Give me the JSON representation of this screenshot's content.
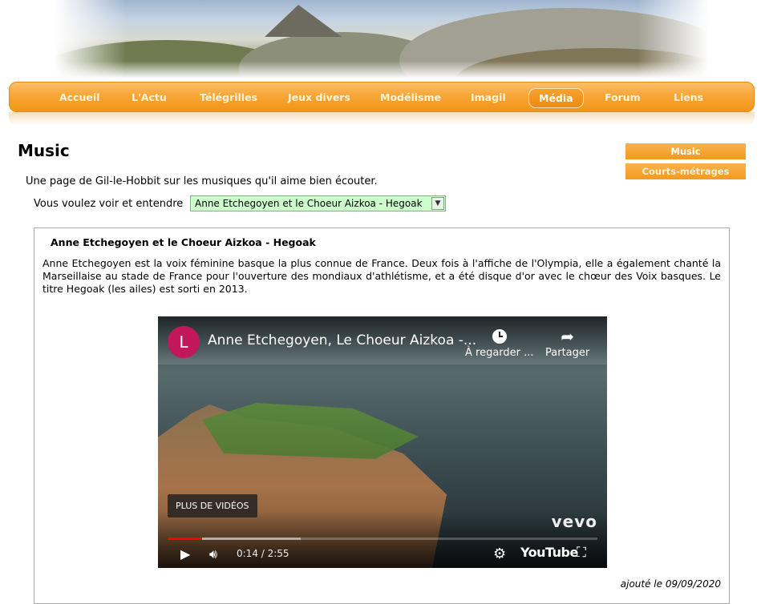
{
  "nav": {
    "items": [
      {
        "label": "Accueil"
      },
      {
        "label": "L'Actu"
      },
      {
        "label": "Télégrilles"
      },
      {
        "label": "Jeux divers"
      },
      {
        "label": "Modélisme"
      },
      {
        "label": "Imagil"
      },
      {
        "label": "Média",
        "active": true
      },
      {
        "label": "Forum"
      },
      {
        "label": "Liens"
      }
    ]
  },
  "page": {
    "title": "Music",
    "intro": "Une page de Gil-le-Hobbit sur les musiques qu'il aime bien écouter.",
    "selector_label": "Vous voulez voir et entendre",
    "selected_value": "Anne Etchegoyen et le Choeur Aizkoa - Hegoak"
  },
  "sidebar": {
    "items": [
      {
        "label": "Music"
      },
      {
        "label": "Courts-métrages"
      }
    ]
  },
  "article": {
    "title": "Anne Etchegoyen et le Choeur Aizkoa - Hegoak",
    "text": "Anne Etchegoyen est la voix féminine basque la plus connue de France. Deux fois à l'affiche de l'Olympia, elle a également chanté la Marseillaise au stade de France pour l'ouverture des mondiaux d'athlétisme, et a été disque d'or avec le chœur des Voix basques. Le titre Hegoak (les ailes) est sorti en 2013.",
    "date": "ajouté le 09/09/2020"
  },
  "video": {
    "channel_initial": "L",
    "title": "Anne Etchegoyen, Le Choeur Aizkoa -...",
    "watch_later": "À regarder ...",
    "share": "Partager",
    "more_videos": "PLUS DE VIDÉOS",
    "vevo": "vevo",
    "time": "0:14 / 2:55",
    "brand": "YouTube",
    "played_fraction": 0.08,
    "buffered_fraction": 0.31
  },
  "colors": {
    "nav_orange": "#f7a637",
    "select_bg": "#ccffcc",
    "progress_red": "#ff0000",
    "channel_icon": "#c2185b"
  }
}
